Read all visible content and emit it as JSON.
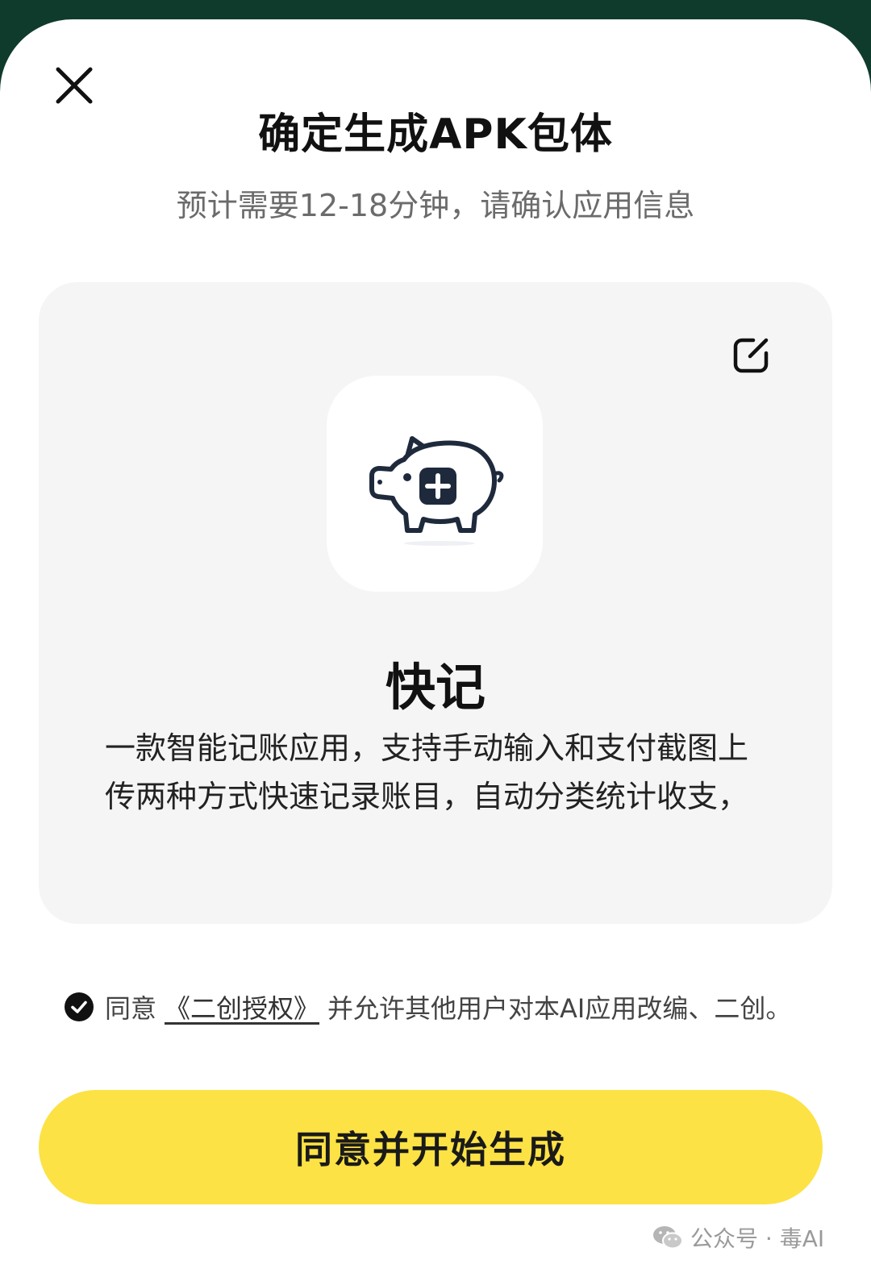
{
  "dialog": {
    "title": "确定生成APK包体",
    "subtitle": "预计需要12-18分钟，请确认应用信息"
  },
  "app": {
    "name": "快记",
    "description": "一款智能记账应用，支持手动输入和支付截图上传两种方式快速记录账目，自动分类统计收支，"
  },
  "agreement": {
    "checked": true,
    "prefix": "同意",
    "link_text": "《二创授权》",
    "suffix": "并允许其他用户对本AI应用改编、二创。"
  },
  "cta": {
    "label": "同意并开始生成"
  },
  "watermark": {
    "text": "公众号 · 毒AI"
  },
  "colors": {
    "cta_background": "#fce244",
    "backdrop": "#0f3b2d",
    "card_background": "#f5f5f5",
    "icon_dark": "#1e2a3c"
  },
  "icons": {
    "close": "close-icon",
    "edit": "edit-icon",
    "app": "piggy-bank-plus-icon",
    "check": "check-circle-icon",
    "watermark": "wechat-icon"
  }
}
